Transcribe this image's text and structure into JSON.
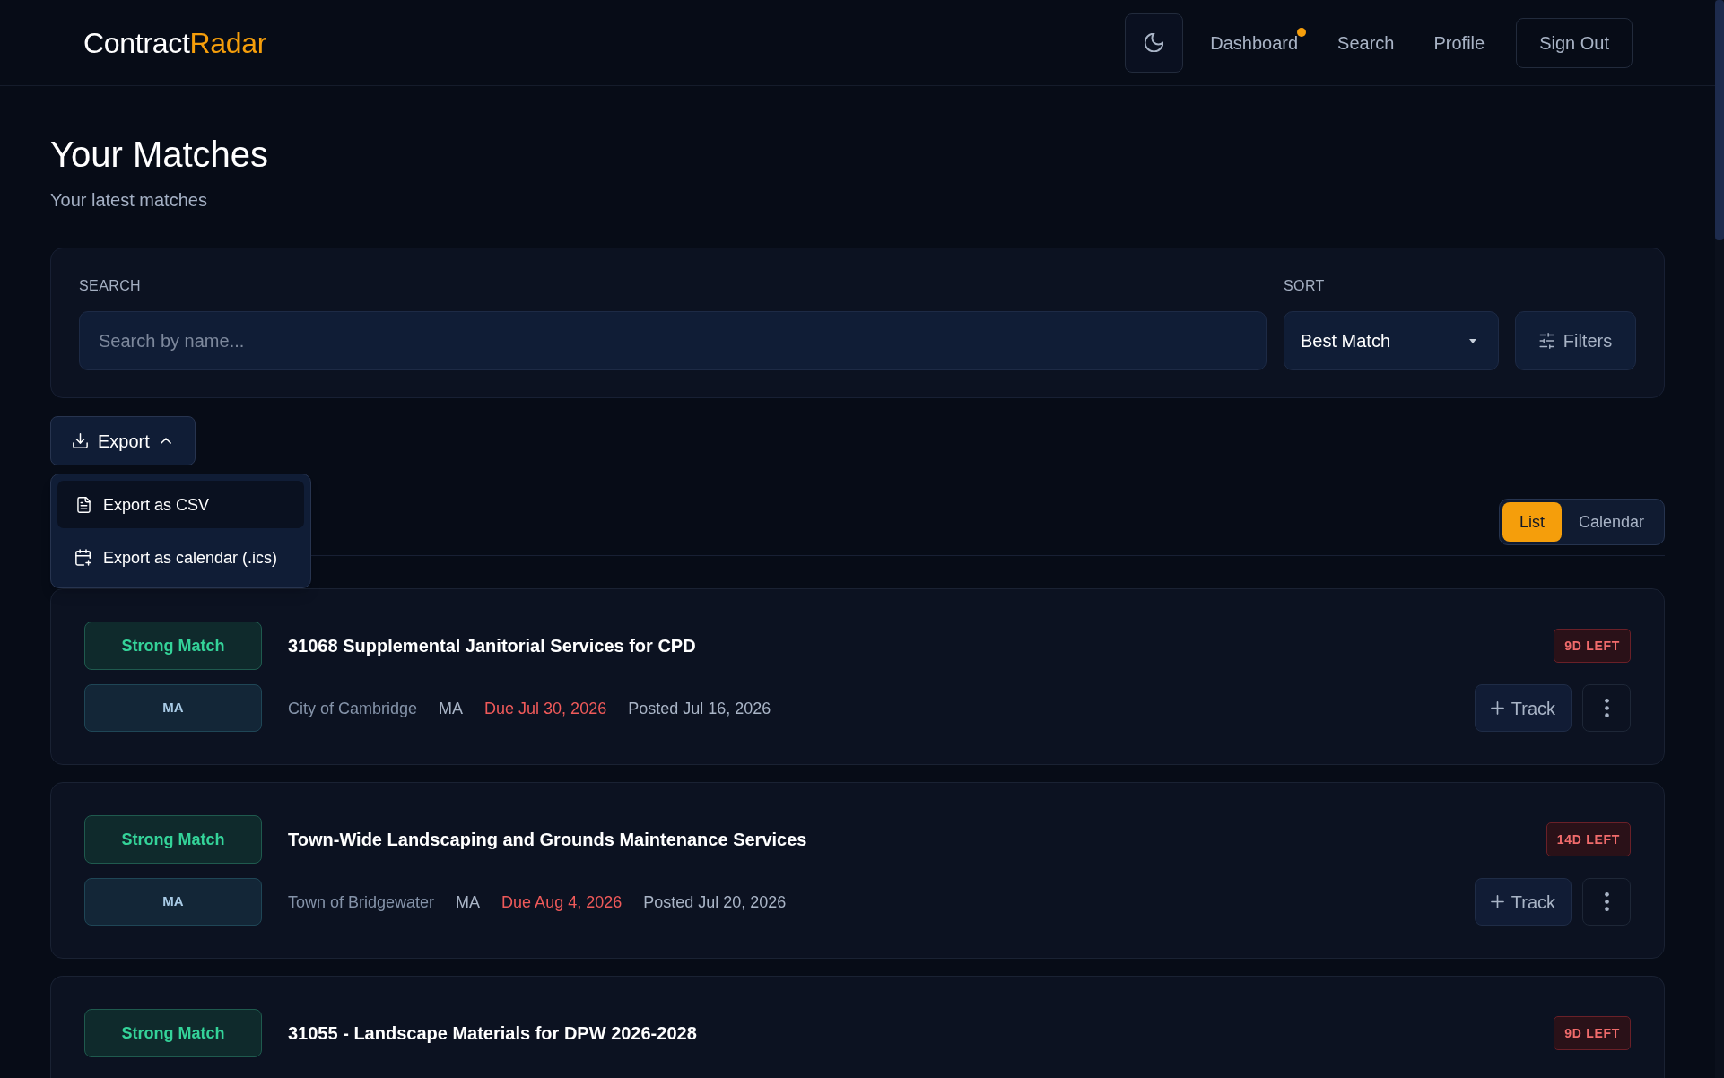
{
  "header": {
    "logo": {
      "primary": "Contract",
      "accent": "Radar"
    },
    "nav": [
      {
        "label": "Dashboard",
        "notification": true
      },
      {
        "label": "Search",
        "notification": false
      },
      {
        "label": "Profile",
        "notification": false
      }
    ],
    "sign_out": "Sign Out"
  },
  "page": {
    "title": "Your Matches",
    "subtitle": "Your latest matches"
  },
  "filters": {
    "search_label": "SEARCH",
    "search_placeholder": "Search by name...",
    "sort_label": "SORT",
    "sort_value": "Best Match",
    "filters_button": "Filters"
  },
  "export": {
    "label": "Export",
    "expanded": true,
    "menu": [
      {
        "label": "Export as CSV",
        "kind": "file",
        "highlighted": true
      },
      {
        "label": "Export as calendar (.ics)",
        "kind": "calendar",
        "highlighted": false
      }
    ]
  },
  "view_toggle": [
    {
      "label": "List",
      "selected": true
    },
    {
      "label": "Calendar",
      "selected": false
    }
  ],
  "matches": [
    {
      "match": "Strong Match",
      "title": "31068 Supplemental Janitorial Services for CPD",
      "days_left": "9D LEFT",
      "state_badge": "MA",
      "agency": "City of Cambridge",
      "state": "MA",
      "due": "Due Jul 30, 2026",
      "posted": "Posted Jul 16, 2026",
      "track": "Track"
    },
    {
      "match": "Strong Match",
      "title": "Town-Wide Landscaping and Grounds Maintenance Services",
      "days_left": "14D LEFT",
      "state_badge": "MA",
      "agency": "Town of Bridgewater",
      "state": "MA",
      "due": "Due Aug 4, 2026",
      "posted": "Posted Jul 20, 2026",
      "track": "Track"
    },
    {
      "match": "Strong Match",
      "title": "31055 - Landscape Materials for DPW 2026-2028",
      "days_left": "9D LEFT"
    }
  ]
}
